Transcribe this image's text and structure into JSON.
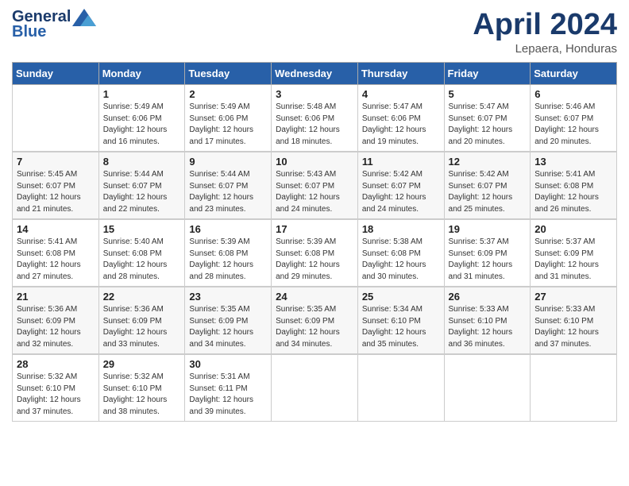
{
  "header": {
    "logo_general": "General",
    "logo_blue": "Blue",
    "title": "April 2024",
    "location": "Lepaera, Honduras"
  },
  "days_of_week": [
    "Sunday",
    "Monday",
    "Tuesday",
    "Wednesday",
    "Thursday",
    "Friday",
    "Saturday"
  ],
  "weeks": [
    [
      {
        "day": "",
        "sunrise": "",
        "sunset": "",
        "daylight": ""
      },
      {
        "day": "1",
        "sunrise": "Sunrise: 5:49 AM",
        "sunset": "Sunset: 6:06 PM",
        "daylight": "Daylight: 12 hours and 16 minutes."
      },
      {
        "day": "2",
        "sunrise": "Sunrise: 5:49 AM",
        "sunset": "Sunset: 6:06 PM",
        "daylight": "Daylight: 12 hours and 17 minutes."
      },
      {
        "day": "3",
        "sunrise": "Sunrise: 5:48 AM",
        "sunset": "Sunset: 6:06 PM",
        "daylight": "Daylight: 12 hours and 18 minutes."
      },
      {
        "day": "4",
        "sunrise": "Sunrise: 5:47 AM",
        "sunset": "Sunset: 6:06 PM",
        "daylight": "Daylight: 12 hours and 19 minutes."
      },
      {
        "day": "5",
        "sunrise": "Sunrise: 5:47 AM",
        "sunset": "Sunset: 6:07 PM",
        "daylight": "Daylight: 12 hours and 20 minutes."
      },
      {
        "day": "6",
        "sunrise": "Sunrise: 5:46 AM",
        "sunset": "Sunset: 6:07 PM",
        "daylight": "Daylight: 12 hours and 20 minutes."
      }
    ],
    [
      {
        "day": "7",
        "sunrise": "Sunrise: 5:45 AM",
        "sunset": "Sunset: 6:07 PM",
        "daylight": "Daylight: 12 hours and 21 minutes."
      },
      {
        "day": "8",
        "sunrise": "Sunrise: 5:44 AM",
        "sunset": "Sunset: 6:07 PM",
        "daylight": "Daylight: 12 hours and 22 minutes."
      },
      {
        "day": "9",
        "sunrise": "Sunrise: 5:44 AM",
        "sunset": "Sunset: 6:07 PM",
        "daylight": "Daylight: 12 hours and 23 minutes."
      },
      {
        "day": "10",
        "sunrise": "Sunrise: 5:43 AM",
        "sunset": "Sunset: 6:07 PM",
        "daylight": "Daylight: 12 hours and 24 minutes."
      },
      {
        "day": "11",
        "sunrise": "Sunrise: 5:42 AM",
        "sunset": "Sunset: 6:07 PM",
        "daylight": "Daylight: 12 hours and 24 minutes."
      },
      {
        "day": "12",
        "sunrise": "Sunrise: 5:42 AM",
        "sunset": "Sunset: 6:07 PM",
        "daylight": "Daylight: 12 hours and 25 minutes."
      },
      {
        "day": "13",
        "sunrise": "Sunrise: 5:41 AM",
        "sunset": "Sunset: 6:08 PM",
        "daylight": "Daylight: 12 hours and 26 minutes."
      }
    ],
    [
      {
        "day": "14",
        "sunrise": "Sunrise: 5:41 AM",
        "sunset": "Sunset: 6:08 PM",
        "daylight": "Daylight: 12 hours and 27 minutes."
      },
      {
        "day": "15",
        "sunrise": "Sunrise: 5:40 AM",
        "sunset": "Sunset: 6:08 PM",
        "daylight": "Daylight: 12 hours and 28 minutes."
      },
      {
        "day": "16",
        "sunrise": "Sunrise: 5:39 AM",
        "sunset": "Sunset: 6:08 PM",
        "daylight": "Daylight: 12 hours and 28 minutes."
      },
      {
        "day": "17",
        "sunrise": "Sunrise: 5:39 AM",
        "sunset": "Sunset: 6:08 PM",
        "daylight": "Daylight: 12 hours and 29 minutes."
      },
      {
        "day": "18",
        "sunrise": "Sunrise: 5:38 AM",
        "sunset": "Sunset: 6:08 PM",
        "daylight": "Daylight: 12 hours and 30 minutes."
      },
      {
        "day": "19",
        "sunrise": "Sunrise: 5:37 AM",
        "sunset": "Sunset: 6:09 PM",
        "daylight": "Daylight: 12 hours and 31 minutes."
      },
      {
        "day": "20",
        "sunrise": "Sunrise: 5:37 AM",
        "sunset": "Sunset: 6:09 PM",
        "daylight": "Daylight: 12 hours and 31 minutes."
      }
    ],
    [
      {
        "day": "21",
        "sunrise": "Sunrise: 5:36 AM",
        "sunset": "Sunset: 6:09 PM",
        "daylight": "Daylight: 12 hours and 32 minutes."
      },
      {
        "day": "22",
        "sunrise": "Sunrise: 5:36 AM",
        "sunset": "Sunset: 6:09 PM",
        "daylight": "Daylight: 12 hours and 33 minutes."
      },
      {
        "day": "23",
        "sunrise": "Sunrise: 5:35 AM",
        "sunset": "Sunset: 6:09 PM",
        "daylight": "Daylight: 12 hours and 34 minutes."
      },
      {
        "day": "24",
        "sunrise": "Sunrise: 5:35 AM",
        "sunset": "Sunset: 6:09 PM",
        "daylight": "Daylight: 12 hours and 34 minutes."
      },
      {
        "day": "25",
        "sunrise": "Sunrise: 5:34 AM",
        "sunset": "Sunset: 6:10 PM",
        "daylight": "Daylight: 12 hours and 35 minutes."
      },
      {
        "day": "26",
        "sunrise": "Sunrise: 5:33 AM",
        "sunset": "Sunset: 6:10 PM",
        "daylight": "Daylight: 12 hours and 36 minutes."
      },
      {
        "day": "27",
        "sunrise": "Sunrise: 5:33 AM",
        "sunset": "Sunset: 6:10 PM",
        "daylight": "Daylight: 12 hours and 37 minutes."
      }
    ],
    [
      {
        "day": "28",
        "sunrise": "Sunrise: 5:32 AM",
        "sunset": "Sunset: 6:10 PM",
        "daylight": "Daylight: 12 hours and 37 minutes."
      },
      {
        "day": "29",
        "sunrise": "Sunrise: 5:32 AM",
        "sunset": "Sunset: 6:10 PM",
        "daylight": "Daylight: 12 hours and 38 minutes."
      },
      {
        "day": "30",
        "sunrise": "Sunrise: 5:31 AM",
        "sunset": "Sunset: 6:11 PM",
        "daylight": "Daylight: 12 hours and 39 minutes."
      },
      {
        "day": "",
        "sunrise": "",
        "sunset": "",
        "daylight": ""
      },
      {
        "day": "",
        "sunrise": "",
        "sunset": "",
        "daylight": ""
      },
      {
        "day": "",
        "sunrise": "",
        "sunset": "",
        "daylight": ""
      },
      {
        "day": "",
        "sunrise": "",
        "sunset": "",
        "daylight": ""
      }
    ]
  ]
}
